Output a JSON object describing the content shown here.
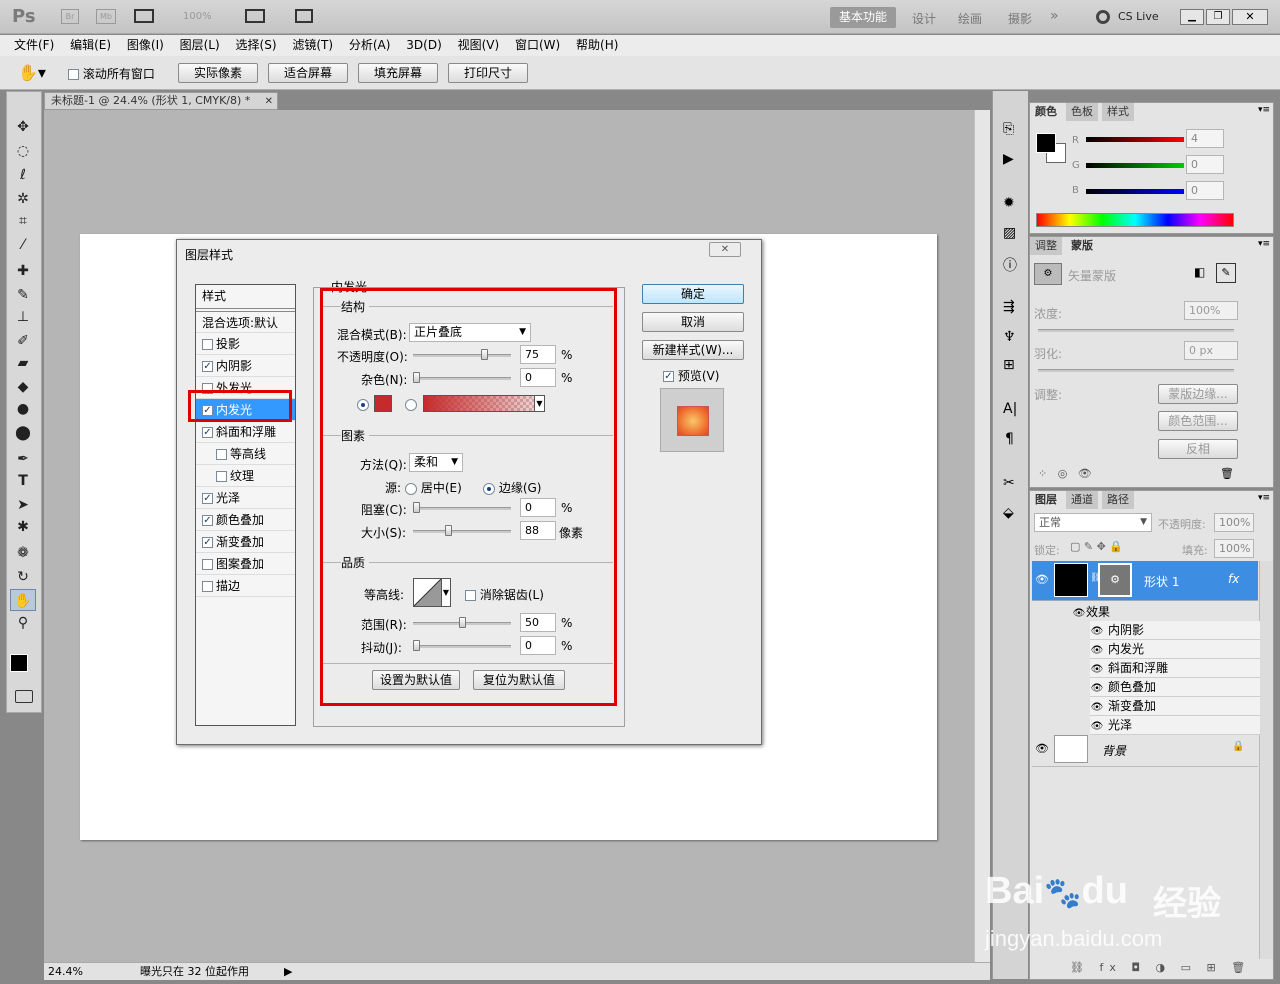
{
  "app": {
    "logo": "Ps",
    "zoom_combo": "100%",
    "workspace_active": "基本功能",
    "workspaces": [
      "设计",
      "绘画",
      "摄影"
    ],
    "cslive": "CS Live"
  },
  "menubar": [
    "文件(F)",
    "编辑(E)",
    "图像(I)",
    "图层(L)",
    "选择(S)",
    "滤镜(T)",
    "分析(A)",
    "3D(D)",
    "视图(V)",
    "窗口(W)",
    "帮助(H)"
  ],
  "options": {
    "scroll_all": "滚动所有窗口",
    "buttons": [
      "实际像素",
      "适合屏幕",
      "填充屏幕",
      "打印尺寸"
    ]
  },
  "document": {
    "tab_title": "未标题-1 @ 24.4% (形状 1, CMYK/8) *",
    "zoom": "24.4%",
    "status": "曝光只在 32 位起作用"
  },
  "dialog": {
    "title": "图层样式",
    "styles_header": "样式",
    "blend_options": "混合选项:默认",
    "styles": [
      {
        "label": "投影",
        "checked": false,
        "indent": false
      },
      {
        "label": "内阴影",
        "checked": true,
        "indent": false
      },
      {
        "label": "外发光",
        "checked": false,
        "indent": false
      },
      {
        "label": "内发光",
        "checked": true,
        "indent": false,
        "selected": true
      },
      {
        "label": "斜面和浮雕",
        "checked": true,
        "indent": false
      },
      {
        "label": "等高线",
        "checked": false,
        "indent": true
      },
      {
        "label": "纹理",
        "checked": false,
        "indent": true
      },
      {
        "label": "光泽",
        "checked": true,
        "indent": false
      },
      {
        "label": "颜色叠加",
        "checked": true,
        "indent": false
      },
      {
        "label": "渐变叠加",
        "checked": true,
        "indent": false
      },
      {
        "label": "图案叠加",
        "checked": false,
        "indent": false
      },
      {
        "label": "描边",
        "checked": false,
        "indent": false
      }
    ],
    "section_title": "内发光",
    "structure": {
      "title": "结构",
      "blend_label": "混合模式(B):",
      "blend_value": "正片叠底",
      "opacity_label": "不透明度(O):",
      "opacity_value": "75",
      "opacity_pct": 75,
      "noise_label": "杂色(N):",
      "noise_value": "0",
      "noise_pct": 0,
      "unit": "%"
    },
    "elements": {
      "title": "图素",
      "technique_label": "方法(Q):",
      "technique_value": "柔和",
      "source_label": "源:",
      "source_center": "居中(E)",
      "source_edge": "边缘(G)",
      "choke_label": "阻塞(C):",
      "choke_value": "0",
      "choke_pct": 0,
      "size_label": "大小(S):",
      "size_value": "88",
      "size_pct": 35,
      "size_unit": "像素",
      "unit": "%"
    },
    "quality": {
      "title": "品质",
      "contour_label": "等高线:",
      "antialias_label": "消除锯齿(L)",
      "range_label": "范围(R):",
      "range_value": "50",
      "range_pct": 50,
      "jitter_label": "抖动(J):",
      "jitter_value": "0",
      "jitter_pct": 0,
      "unit": "%"
    },
    "set_default": "设置为默认值",
    "reset_default": "复位为默认值",
    "ok": "确定",
    "cancel": "取消",
    "new_style": "新建样式(W)...",
    "preview_label": "预览(V)",
    "glow_color": "#c62b2b"
  },
  "color_panel": {
    "tabs": [
      "颜色",
      "色板",
      "样式"
    ],
    "r_label": "R",
    "g_label": "G",
    "b_label": "B",
    "r": "4",
    "g": "0",
    "b": "0"
  },
  "masks_panel": {
    "tabs": [
      "调整",
      "蒙版"
    ],
    "title": "矢量蒙版",
    "density_label": "浓度:",
    "density_value": "100%",
    "feather_label": "羽化:",
    "feather_value": "0 px",
    "refine_label": "调整:",
    "refine_buttons": [
      "蒙版边缘...",
      "颜色范围...",
      "反相"
    ]
  },
  "layers_panel": {
    "tabs": [
      "图层",
      "通道",
      "路径"
    ],
    "blend": "正常",
    "opacity_label": "不透明度:",
    "opacity": "100%",
    "lock_label": "锁定:",
    "fill_label": "填充:",
    "fill": "100%",
    "layer_name": "形状 1",
    "effects_label": "效果",
    "effects": [
      "内阴影",
      "内发光",
      "斜面和浮雕",
      "颜色叠加",
      "渐变叠加",
      "光泽"
    ],
    "background_name": "背景"
  },
  "watermark": {
    "brand": "Bai",
    "paw": "du",
    "cn": "经验",
    "url": "jingyan.baidu.com"
  }
}
